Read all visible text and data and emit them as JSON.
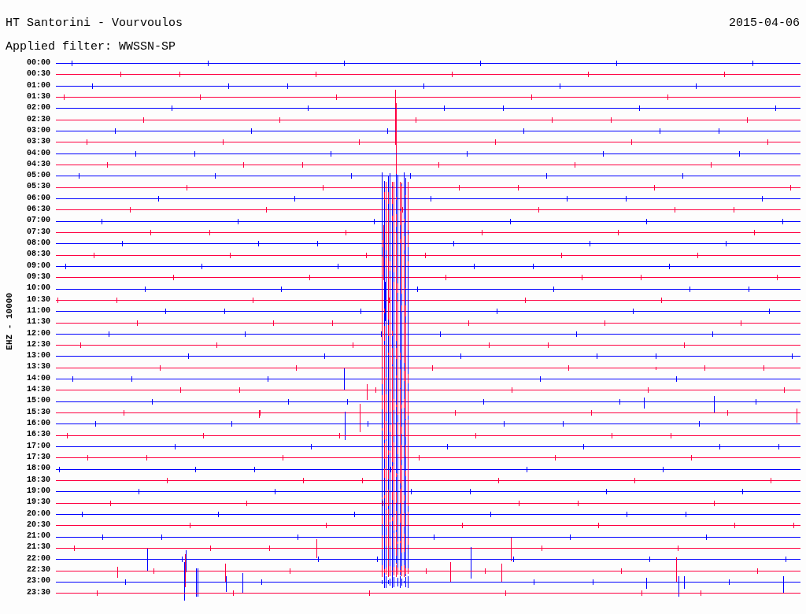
{
  "header": {
    "title": "HT Santorini - Vourvoulos",
    "date": "2015-04-06",
    "filter": "Applied filter: WWSSN-SP"
  },
  "channel_label": "EHZ - 10000",
  "traces": [
    {
      "time": "00:00",
      "color": "#0000ff"
    },
    {
      "time": "00:30",
      "color": "#ff0040"
    },
    {
      "time": "01:00",
      "color": "#0000ff"
    },
    {
      "time": "01:30",
      "color": "#ff0040"
    },
    {
      "time": "02:00",
      "color": "#0000ff"
    },
    {
      "time": "02:30",
      "color": "#ff0040"
    },
    {
      "time": "03:00",
      "color": "#0000ff"
    },
    {
      "time": "03:30",
      "color": "#ff0040"
    },
    {
      "time": "04:00",
      "color": "#0000ff"
    },
    {
      "time": "04:30",
      "color": "#ff0040"
    },
    {
      "time": "05:00",
      "color": "#0000ff"
    },
    {
      "time": "05:30",
      "color": "#ff0040"
    },
    {
      "time": "06:00",
      "color": "#0000ff"
    },
    {
      "time": "06:30",
      "color": "#ff0040"
    },
    {
      "time": "07:00",
      "color": "#0000ff"
    },
    {
      "time": "07:30",
      "color": "#ff0040"
    },
    {
      "time": "08:00",
      "color": "#0000ff"
    },
    {
      "time": "08:30",
      "color": "#ff0040"
    },
    {
      "time": "09:00",
      "color": "#0000ff"
    },
    {
      "time": "09:30",
      "color": "#ff0040"
    },
    {
      "time": "10:00",
      "color": "#0000ff"
    },
    {
      "time": "10:30",
      "color": "#ff0040"
    },
    {
      "time": "11:00",
      "color": "#0000ff"
    },
    {
      "time": "11:30",
      "color": "#ff0040"
    },
    {
      "time": "12:00",
      "color": "#0000ff"
    },
    {
      "time": "12:30",
      "color": "#ff0040"
    },
    {
      "time": "13:00",
      "color": "#0000ff"
    },
    {
      "time": "13:30",
      "color": "#ff0040"
    },
    {
      "time": "14:00",
      "color": "#0000ff"
    },
    {
      "time": "14:30",
      "color": "#ff0040"
    },
    {
      "time": "15:00",
      "color": "#0000ff"
    },
    {
      "time": "15:30",
      "color": "#ff0040"
    },
    {
      "time": "16:00",
      "color": "#0000ff"
    },
    {
      "time": "16:30",
      "color": "#ff0040"
    },
    {
      "time": "17:00",
      "color": "#0000ff"
    },
    {
      "time": "17:30",
      "color": "#ff0040"
    },
    {
      "time": "18:00",
      "color": "#0000ff"
    },
    {
      "time": "18:30",
      "color": "#ff0040"
    },
    {
      "time": "19:00",
      "color": "#0000ff"
    },
    {
      "time": "19:30",
      "color": "#ff0040"
    },
    {
      "time": "20:00",
      "color": "#0000ff"
    },
    {
      "time": "20:30",
      "color": "#ff0040"
    },
    {
      "time": "21:00",
      "color": "#0000ff"
    },
    {
      "time": "21:30",
      "color": "#ff0040"
    },
    {
      "time": "22:00",
      "color": "#0000ff"
    },
    {
      "time": "22:30",
      "color": "#ff0040"
    },
    {
      "time": "23:00",
      "color": "#0000ff"
    },
    {
      "time": "23:30",
      "color": "#ff0040"
    }
  ]
}
